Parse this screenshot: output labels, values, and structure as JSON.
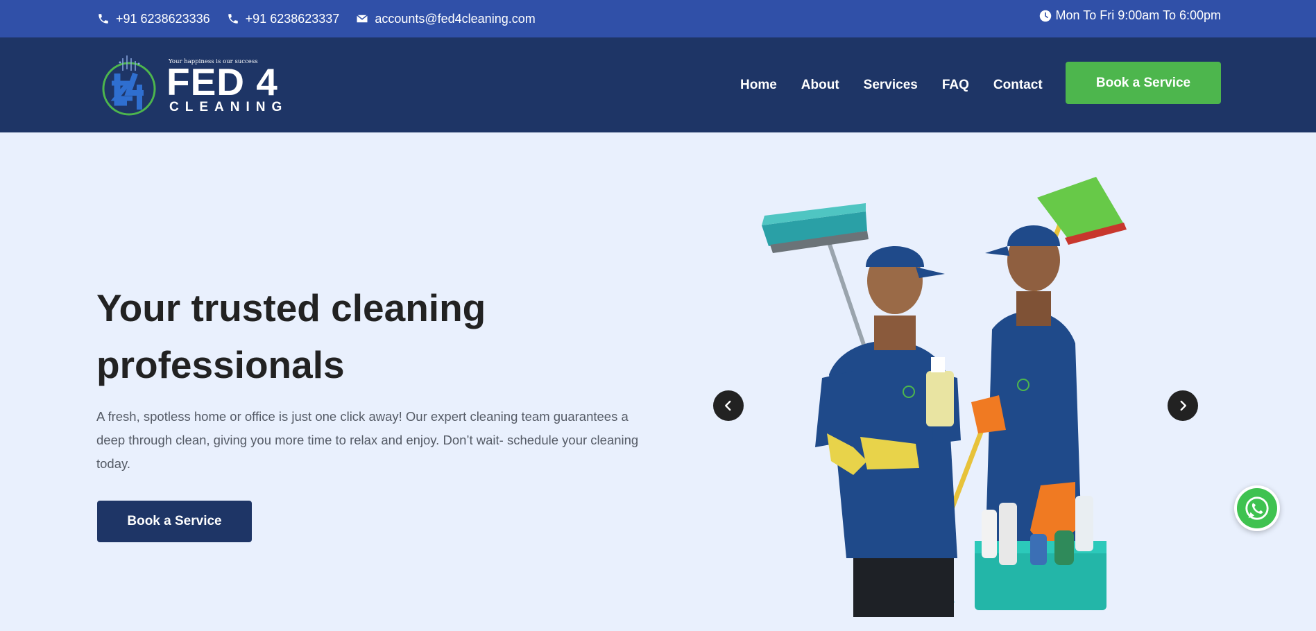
{
  "topbar": {
    "phone1": "+91 6238623336",
    "phone2": "+91 6238623337",
    "email": "accounts@fed4cleaning.com",
    "hours": "Mon To Fri 9:00am To 6:00pm",
    "icons": [
      "phone-icon",
      "phone-icon",
      "envelope-icon",
      "clock-icon"
    ]
  },
  "header": {
    "logo": {
      "tagline": "Your happiness is our success",
      "name": "FED 4",
      "sub": "CLEANING"
    },
    "nav": [
      "Home",
      "About",
      "Services",
      "FAQ",
      "Contact"
    ],
    "cta": "Book a Service"
  },
  "hero": {
    "title": "Your trusted cleaning professionals",
    "text": "A fresh, spotless home or office is just one click away! Our expert cleaning team guarantees a deep through clean, giving you more time to relax and enjoy. Don’t wait- schedule your cleaning today.",
    "cta": "Book a Service",
    "carousel_icons": [
      "chevron-left-icon",
      "chevron-right-icon"
    ]
  },
  "whatsapp": {
    "icon": "whatsapp-icon"
  },
  "colors": {
    "topbar": "#3050a8",
    "header": "#1e3566",
    "accent_green": "#4db64d",
    "hero_bg": "#e9f0fd",
    "title": "#222222"
  }
}
